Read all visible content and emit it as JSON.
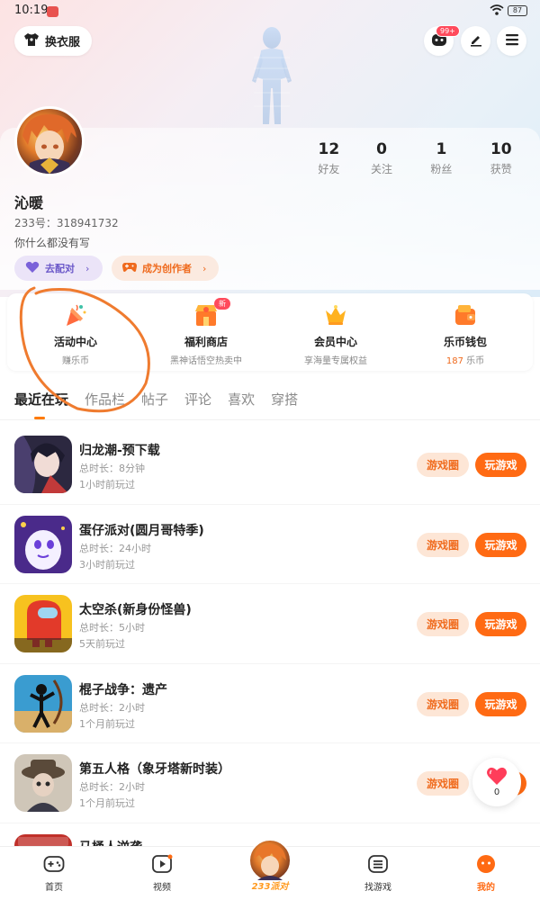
{
  "status_bar": {
    "time": "10:19",
    "battery": "87"
  },
  "header": {
    "outfit_label": "换衣服",
    "notification_badge": "99+"
  },
  "profile": {
    "nickname": "沁暖",
    "user_id": "233号：318941732",
    "bio": "你什么都没有写",
    "match_label": "去配对",
    "creator_label": "成为创作者",
    "stats": [
      {
        "num": "12",
        "label": "好友"
      },
      {
        "num": "0",
        "label": "关注"
      },
      {
        "num": "1",
        "label": "粉丝"
      },
      {
        "num": "10",
        "label": "获赞"
      }
    ]
  },
  "quick_entries": [
    {
      "title": "活动中心",
      "sub": "赚乐币"
    },
    {
      "title": "福利商店",
      "sub": "黑神话悟空热卖中",
      "badge": "新"
    },
    {
      "title": "会员中心",
      "sub": "享海量专属权益"
    },
    {
      "title": "乐币钱包",
      "sub_num": "187",
      "sub_unit": " 乐币"
    }
  ],
  "tabs": [
    "最近在玩",
    "作品栏",
    "帖子",
    "评论",
    "喜欢",
    "穿搭"
  ],
  "game_buttons": {
    "circle": "游戏圈",
    "play": "玩游戏"
  },
  "games": [
    {
      "name": "归龙潮-预下载",
      "duration": "总时长：8分钟",
      "last_played": "1小时前玩过"
    },
    {
      "name": "蛋仔派对(圆月哥特季)",
      "duration": "总时长：24小时",
      "last_played": "3小时前玩过"
    },
    {
      "name": "太空杀(新身份怪兽)",
      "duration": "总时长：5小时",
      "last_played": "5天前玩过"
    },
    {
      "name": "棍子战争：遗产",
      "duration": "总时长：2小时",
      "last_played": "1个月前玩过"
    },
    {
      "name": "第五人格（象牙塔新时装）",
      "duration": "总时长：2小时",
      "last_played": "1个月前玩过"
    }
  ],
  "partial_game": {
    "name": "马桶人逆袭"
  },
  "fab": {
    "count": "0"
  },
  "bottom_nav": [
    {
      "label": "首页"
    },
    {
      "label": "视频"
    },
    {
      "label": "233派对"
    },
    {
      "label": "找游戏"
    },
    {
      "label": "我的"
    }
  ],
  "colors": {
    "accent": "#ff6a13",
    "annotation": "#ef7b2f"
  }
}
